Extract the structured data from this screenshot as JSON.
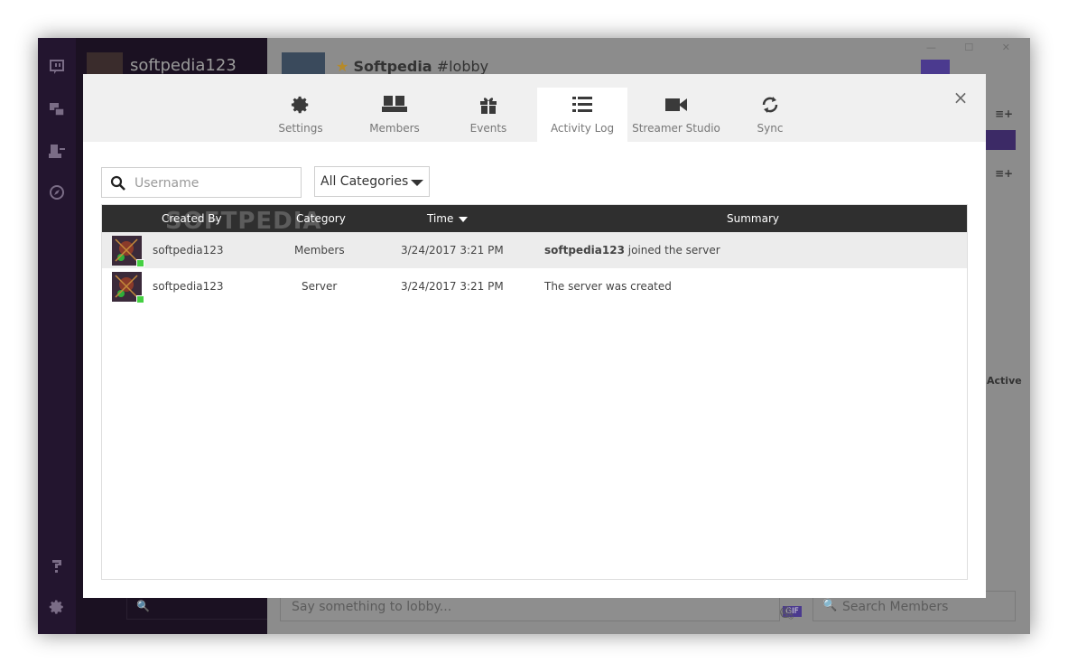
{
  "app": {
    "server_name": "softpedia123",
    "channel_server": "Softpedia",
    "channel_name": "#lobby",
    "chat_placeholder": "Say something to lobby...",
    "member_search_placeholder": "Search Members",
    "active_label": "Active",
    "gif_label": "GIF"
  },
  "modal": {
    "tabs": [
      {
        "label": "Settings",
        "icon": "gear-icon"
      },
      {
        "label": "Members",
        "icon": "members-icon"
      },
      {
        "label": "Events",
        "icon": "gift-icon"
      },
      {
        "label": "Activity Log",
        "icon": "list-icon",
        "active": true
      },
      {
        "label": "Streamer Studio",
        "icon": "video-camera-icon"
      },
      {
        "label": "Sync",
        "icon": "sync-icon"
      }
    ],
    "close_label": "×",
    "filters": {
      "username_placeholder": "Username",
      "category_value": "All Categories"
    },
    "table": {
      "headers": {
        "created_by": "Created By",
        "category": "Category",
        "time": "Time",
        "summary": "Summary"
      },
      "watermark": "SOFTPEDIA",
      "rows": [
        {
          "user": "softpedia123",
          "category": "Members",
          "time": "3/24/2017 3:21 PM",
          "summary_bold": "softpedia123",
          "summary_rest": " joined the server"
        },
        {
          "user": "softpedia123",
          "category": "Server",
          "time": "3/24/2017 3:21 PM",
          "summary_bold": "",
          "summary_rest": "The server was created"
        }
      ]
    }
  },
  "colors": {
    "rail": "#23152f",
    "accent": "#4b3a8f",
    "header_dark": "#2f2f2f",
    "online": "#45d042"
  }
}
